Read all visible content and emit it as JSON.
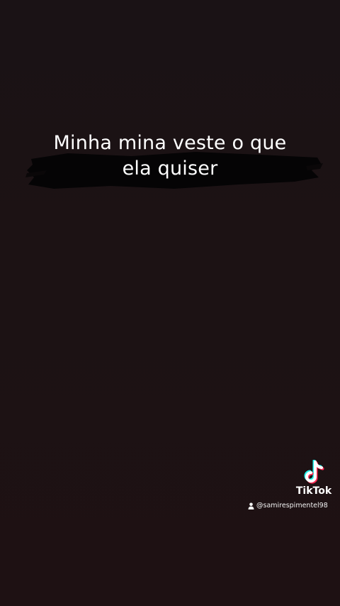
{
  "caption": {
    "line1": "Minha mina veste o que",
    "line2": "ela quiser"
  },
  "watermark": {
    "brand": "TikTok",
    "handle": "@samirespimentel98",
    "logo_icon": "tiktok-note-icon",
    "user_icon": "user-icon"
  },
  "colors": {
    "background": "#1b1214",
    "text": "#ffffff",
    "brush": "#050405",
    "logo_cyan": "#25f4ee",
    "logo_red": "#fe2c55"
  }
}
